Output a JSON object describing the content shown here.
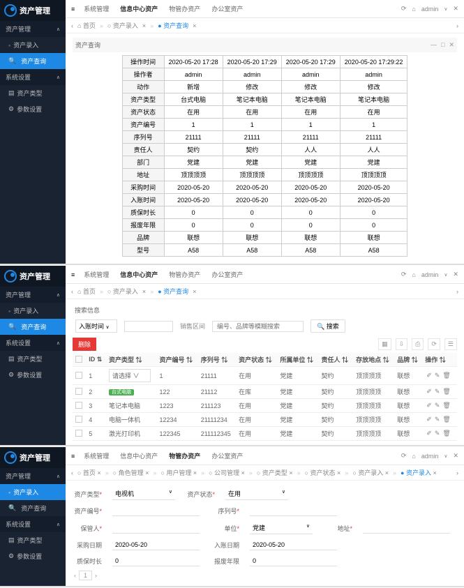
{
  "app": {
    "name": "资产管理"
  },
  "sidebar": {
    "groups": [
      {
        "label": "资产管理",
        "items": [
          {
            "label": "资产录入"
          },
          {
            "label": "资产查询"
          }
        ]
      },
      {
        "label": "系统设置",
        "items": [
          {
            "label": "资产类型"
          },
          {
            "label": "参数设置"
          }
        ]
      }
    ]
  },
  "topbar": {
    "items": [
      "系统管理",
      "信息中心资产",
      "物管办资产",
      "办公室资产"
    ],
    "user": "admin"
  },
  "breadcrumb": {
    "home": "首页",
    "items": [
      "资产录入",
      "资产查询"
    ]
  },
  "panel1": {
    "title": "资产查询",
    "rows": [
      {
        "k": "操作时间",
        "v": [
          "2020-05-20 17:28",
          "2020-05-20 17:29",
          "2020-05-20 17:29",
          "2020-05-20 17:29:22"
        ]
      },
      {
        "k": "操作者",
        "v": [
          "admin",
          "admin",
          "admin",
          "admin"
        ]
      },
      {
        "k": "动作",
        "v": [
          "新增",
          "修改",
          "修改",
          "修改"
        ]
      },
      {
        "k": "资产类型",
        "v": [
          "台式电脑",
          "笔记本电脑",
          "笔记本电脑",
          "笔记本电脑"
        ]
      },
      {
        "k": "资产状态",
        "v": [
          "在用",
          "在用",
          "在用",
          "在用"
        ]
      },
      {
        "k": "资产编号",
        "v": [
          "1",
          "1",
          "1",
          "1"
        ]
      },
      {
        "k": "序列号",
        "v": [
          "21111",
          "21111",
          "21111",
          "21111"
        ]
      },
      {
        "k": "责任人",
        "v": [
          "契约",
          "契约",
          "人人",
          "人人"
        ]
      },
      {
        "k": "部门",
        "v": [
          "党建",
          "党建",
          "党建",
          "党建"
        ]
      },
      {
        "k": "地址",
        "v": [
          "顶顶顶顶",
          "顶顶顶顶",
          "顶顶顶顶",
          "顶顶顶顶"
        ]
      },
      {
        "k": "采购时间",
        "v": [
          "2020-05-20",
          "2020-05-20",
          "2020-05-20",
          "2020-05-20"
        ]
      },
      {
        "k": "入账时间",
        "v": [
          "2020-05-20",
          "2020-05-20",
          "2020-05-20",
          "2020-05-20"
        ]
      },
      {
        "k": "质保时长",
        "v": [
          "0",
          "0",
          "0",
          "0"
        ]
      },
      {
        "k": "报废年限",
        "v": [
          "0",
          "0",
          "0",
          "0"
        ]
      },
      {
        "k": "品牌",
        "v": [
          "联想",
          "联想",
          "联想",
          "联想"
        ]
      },
      {
        "k": "型号",
        "v": [
          "A58",
          "A58",
          "A58",
          "A58"
        ]
      }
    ]
  },
  "panel2": {
    "section": "搜索信息",
    "filter_time": "入账时间",
    "keyword_ph": "编号、品牌等模糊搜索",
    "search_btn": "搜索",
    "del_btn": "删除",
    "range_label": "销售区间",
    "cols": [
      "",
      "ID",
      "资产类型",
      "资产编号",
      "序列号",
      "资产状态",
      "所属单位",
      "责任人",
      "存放地点",
      "品牌",
      "操作"
    ],
    "rows": [
      {
        "id": "1",
        "type_sel": "请选择",
        "c3": "1",
        "c4": "21111",
        "c5": "在用",
        "c6": "党建",
        "c7": "契约",
        "c8": "顶顶顶顶",
        "c9": "联想"
      },
      {
        "id": "2",
        "type": "台式电脑",
        "c3": "122",
        "c4": "21112",
        "c5": "在库",
        "c6": "党建",
        "c7": "契约",
        "c8": "顶顶顶顶",
        "c9": "联想"
      },
      {
        "id": "3",
        "type": "笔记本电脑",
        "c3": "1223",
        "c4": "211123",
        "c5": "在用",
        "c6": "党建",
        "c7": "契约",
        "c8": "顶顶顶顶",
        "c9": "联想"
      },
      {
        "id": "4",
        "type": "电脑一体机",
        "c3": "12234",
        "c4": "21111234",
        "c5": "在用",
        "c6": "党建",
        "c7": "契约",
        "c8": "顶顶顶顶",
        "c9": "联想"
      },
      {
        "id": "5",
        "type": "激光打印机",
        "c3": "122345",
        "c4": "211112345",
        "c5": "在用",
        "c6": "党建",
        "c7": "契约",
        "c8": "顶顶顶顶",
        "c9": "联想"
      }
    ]
  },
  "panel3": {
    "tabs": {
      "items": [
        "首页",
        "角色管理",
        "用户管理",
        "公司管理",
        "资产类型",
        "资产状态",
        "资产录入",
        "资产录入"
      ]
    },
    "form": {
      "type_label": "资产类型",
      "type_val": "电视机",
      "status_label": "资产状态",
      "status_val": "在用",
      "num_label": "资产编号",
      "serial_label": "序列号",
      "owner_label": "保管人",
      "dept_label": "单位",
      "dept_val": "党建",
      "addr_label": "地址",
      "buy_label": "采购日期",
      "buy_val": "2020-05-20",
      "in_label": "入账日期",
      "in_val": "2020-05-20",
      "warranty_label": "质保时长",
      "warranty_val": "0",
      "scrap_label": "报废年限",
      "scrap_val": "0"
    }
  }
}
